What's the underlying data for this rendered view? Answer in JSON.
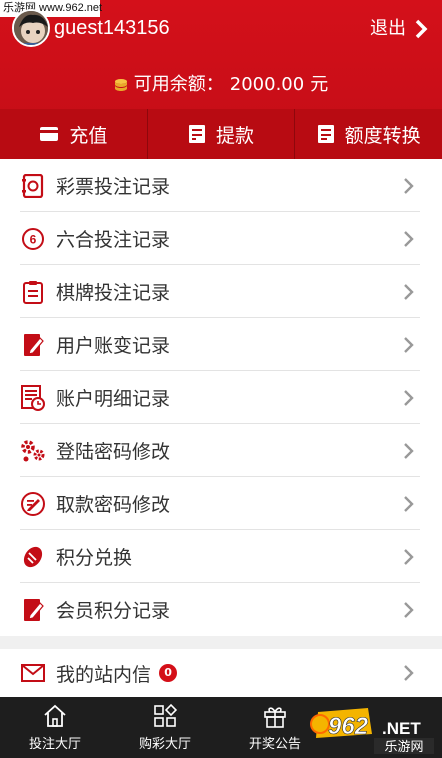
{
  "watermark": "乐游网 www.962.net",
  "user": {
    "name": "guest143156"
  },
  "header": {
    "logout_label": "退出"
  },
  "balance": {
    "label": "可用余额：",
    "amount": "2000.00",
    "unit": "元"
  },
  "actions": [
    {
      "label": "充值",
      "icon": "card-icon"
    },
    {
      "label": "提款",
      "icon": "withdraw-icon"
    },
    {
      "label": "额度转换",
      "icon": "transfer-icon"
    }
  ],
  "menu": [
    {
      "label": "彩票投注记录",
      "icon": "lottery-record-icon"
    },
    {
      "label": "六合投注记录",
      "icon": "six-circle-icon"
    },
    {
      "label": "棋牌投注记录",
      "icon": "clipboard-icon"
    },
    {
      "label": "用户账变记录",
      "icon": "notebook-pen-icon"
    },
    {
      "label": "账户明细记录",
      "icon": "statement-clock-icon"
    },
    {
      "label": "登陆密码修改",
      "icon": "gears-icon"
    },
    {
      "label": "取款密码修改",
      "icon": "edit-circle-icon"
    },
    {
      "label": "积分兑换",
      "icon": "exchange-icon"
    },
    {
      "label": "会员积分记录",
      "icon": "notebook-pen-icon"
    }
  ],
  "messages": {
    "label": "我的站内信",
    "count": "0"
  },
  "tabbar": [
    {
      "label": "投注大厅",
      "icon": "home-icon"
    },
    {
      "label": "购彩大厅",
      "icon": "grid-icon"
    },
    {
      "label": "开奖公告",
      "icon": "gift-icon"
    }
  ],
  "logo": {
    "big": "962",
    "net": ".NET",
    "cn": "乐游网"
  },
  "colors": {
    "brand_red": "#c30d16",
    "tabbar": "#1e1e1e"
  }
}
